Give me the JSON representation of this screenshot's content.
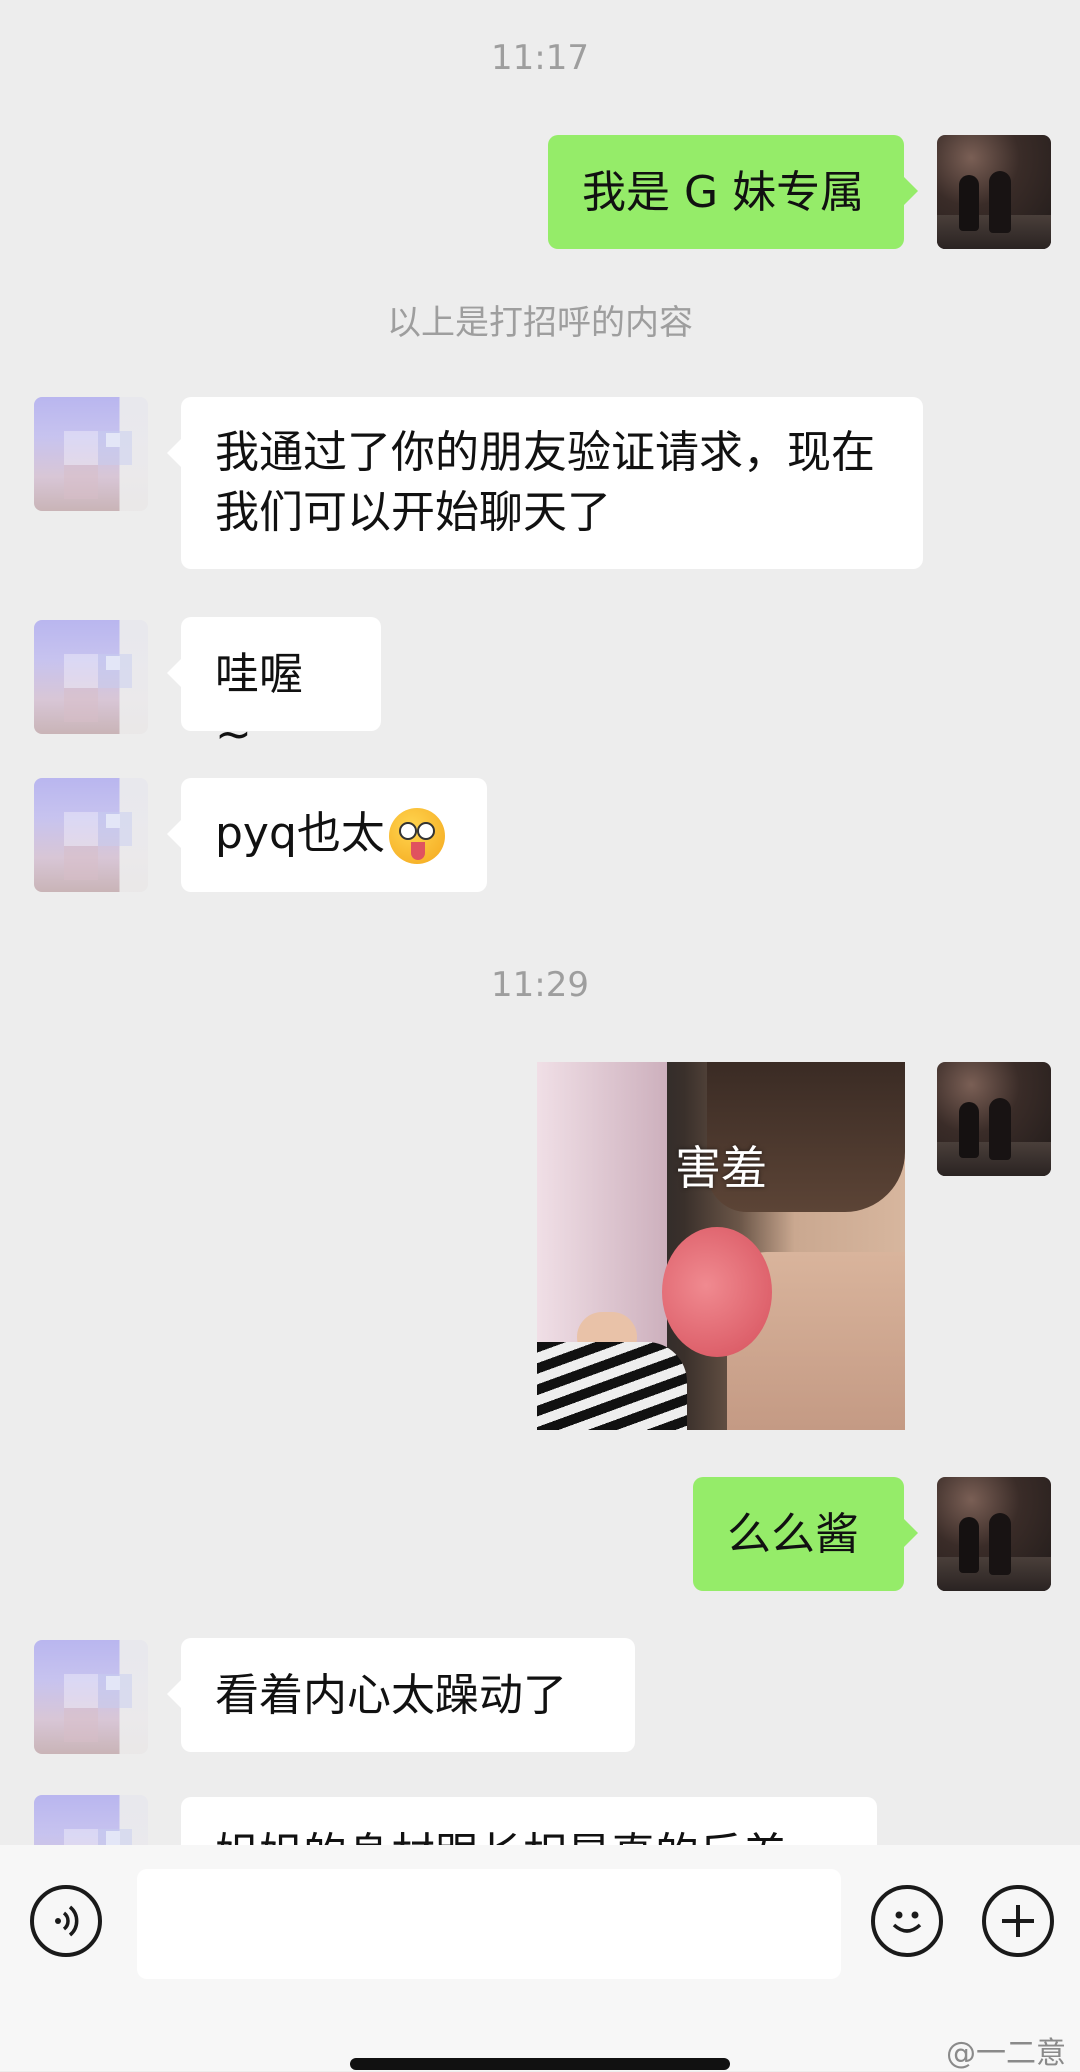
{
  "messages": {
    "time1": "11:17",
    "m1": "我是 G 妹专属",
    "system": "以上是打招呼的内容",
    "m2": "我通过了你的朋友验证请求，现在我们可以开始聊天了",
    "m3": "哇喔 ~",
    "m4_text": "pyq也太",
    "m4_emoji": "drooling-star-eyes-emoji",
    "time2": "11:29",
    "sticker_caption": "害羞",
    "m5": "么么酱",
    "m6": "看着内心太躁动了",
    "m7_partial": "姐姐的身材跟长相是真的反差"
  },
  "input": {
    "placeholder": ""
  },
  "icons": {
    "voice": "voice-icon",
    "emoji": "emoji-icon",
    "plus": "plus-icon"
  },
  "watermark": "@一二意",
  "colors": {
    "background": "#ededed",
    "outgoing_bubble": "#95ec69",
    "incoming_bubble": "#ffffff"
  }
}
